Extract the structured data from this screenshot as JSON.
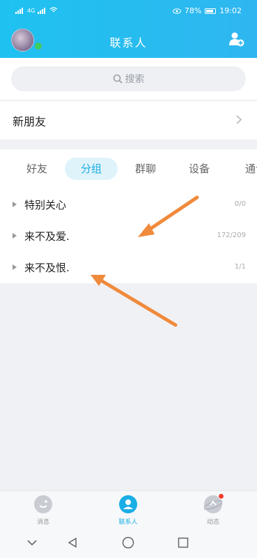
{
  "status_bar": {
    "network": "4G",
    "battery": "78%",
    "time": "19:02"
  },
  "header": {
    "title": "联系人"
  },
  "search": {
    "label": "搜索"
  },
  "new_friends": {
    "label": "新朋友"
  },
  "tabs": [
    {
      "label": "好友"
    },
    {
      "label": "分组"
    },
    {
      "label": "群聊"
    },
    {
      "label": "设备"
    },
    {
      "label": "通讯"
    }
  ],
  "groups": [
    {
      "name": "特别关心",
      "count": "0/0"
    },
    {
      "name": "来不及爱.",
      "count": "172/209"
    },
    {
      "name": "来不及恨.",
      "count": "1/1"
    }
  ],
  "bottom_nav": [
    {
      "label": "消息",
      "icon": "message-icon"
    },
    {
      "label": "联系人",
      "icon": "contacts-icon"
    },
    {
      "label": "动态",
      "icon": "planet-icon"
    }
  ],
  "colors": {
    "header_bg": "#2fb6f0",
    "accent": "#19aee6",
    "online": "#3ccf5e",
    "arrow": "#f08a3c",
    "badge": "#f23b2f"
  }
}
